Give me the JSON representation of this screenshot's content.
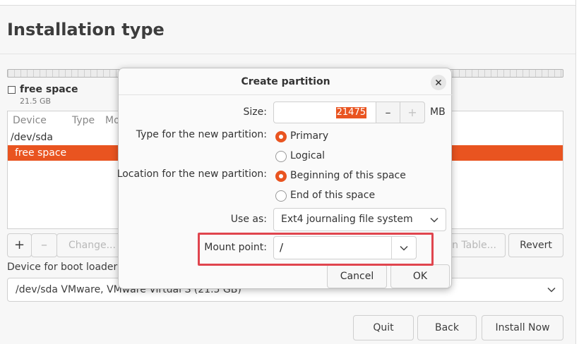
{
  "page": {
    "title": "Installation type"
  },
  "free_space": {
    "title": "free space",
    "size": "21.5 GB"
  },
  "partition_table": {
    "columns": [
      "Device",
      "Type",
      "Mo"
    ],
    "rows": [
      {
        "device": "/dev/sda"
      },
      {
        "device": "free space",
        "selected": true
      }
    ]
  },
  "table_toolbar": {
    "add": "+",
    "remove": "–",
    "change": "Change...",
    "new_table": "n Table...",
    "revert": "Revert"
  },
  "boot_loader": {
    "label": "Device for boot loader i",
    "selected": "/dev/sda   VMware, VMware Virtual S (21.5 GB)"
  },
  "footer_buttons": {
    "quit": "Quit",
    "back": "Back",
    "install_now": "Install Now"
  },
  "dialog": {
    "title": "Create partition",
    "size_label": "Size:",
    "size_value": "21475",
    "size_unit": "MB",
    "minus": "–",
    "plus": "+",
    "type_label": "Type for the new partition:",
    "type_options": [
      "Primary",
      "Logical"
    ],
    "type_selected": "Primary",
    "location_label": "Location for the new partition:",
    "location_options": [
      "Beginning of this space",
      "End of this space"
    ],
    "location_selected": "Beginning of this space",
    "use_as_label": "Use as:",
    "use_as_value": "Ext4 journaling file system",
    "mount_label": "Mount point:",
    "mount_value": "/",
    "cancel": "Cancel",
    "ok": "OK"
  },
  "colors": {
    "accent": "#e95420",
    "highlight_box": "#e0454e"
  },
  "icons": {
    "close": "close-icon",
    "chevron": "chevron-down-icon"
  }
}
